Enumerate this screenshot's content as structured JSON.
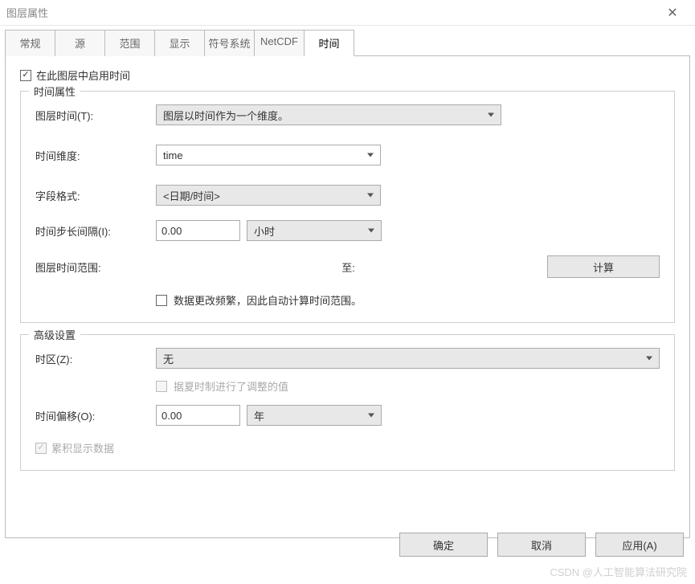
{
  "window": {
    "title": "图层属性"
  },
  "tabs": {
    "t1": "常规",
    "t2": "源",
    "t3": "范围",
    "t4": "显示",
    "t5": "符号系统",
    "t6": "NetCDF",
    "t7": "时间"
  },
  "enable_time_label": "在此图层中启用时间",
  "time_props": {
    "legend": "时间属性",
    "layer_time_label": "图层时间(T):",
    "layer_time_value": "图层以时间作为一个维度。",
    "time_dim_label": "时间维度:",
    "time_dim_value": "time",
    "field_format_label": "字段格式:",
    "field_format_value": "<日期/时间>",
    "step_interval_label": "时间步长间隔(I):",
    "step_interval_value": "0.00",
    "step_interval_unit": "小时",
    "time_range_label": "图层时间范围:",
    "time_range_to": "至:",
    "calc_button": "计算",
    "freq_change_label": "数据更改频繁，因此自动计算时间范围。"
  },
  "advanced": {
    "legend": "高级设置",
    "tz_label": "时区(Z):",
    "tz_value": "无",
    "dst_label": "据夏时制进行了调整的值",
    "offset_label": "时间偏移(O):",
    "offset_value": "0.00",
    "offset_unit": "年",
    "cumulative_label": "累积显示数据"
  },
  "buttons": {
    "ok": "确定",
    "cancel": "取消",
    "apply": "应用(A)"
  },
  "watermark": "CSDN @人工智能算法研究院"
}
